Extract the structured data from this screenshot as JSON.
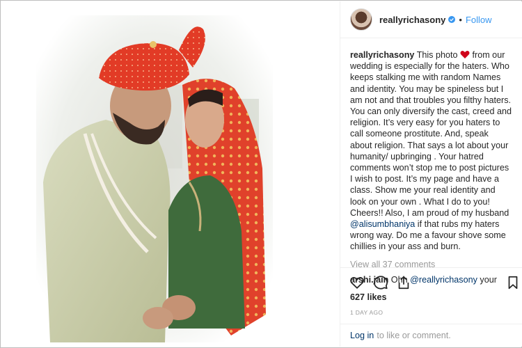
{
  "post": {
    "username": "reallyrichasony",
    "dot": "•",
    "follow_label": "Follow",
    "caption_user": "reallyrichasony",
    "caption_part1": "This photo",
    "caption_part2": "from our wedding is especially for the haters. Who keeps stalking me with random Names and identity. You may be spineless but I am not and that troubles you filthy haters. You can only diversify the cast, creed and religion. It’s very easy for you haters to call someone prostitute. And, speak about religion. That says a lot about your humanity/ upbringing . Your hatred comments won’t stop me to post pictures I wish to post. It’s my page and have a class. Show me your real identity and look on your own . What I do to you! Cheers!! Also, I am proud of my husband",
    "caption_mention": "@alisumbhaniya",
    "caption_part3": "if that rubs my haters wrong way. Do me a favour shove some chillies in your ass and burn.",
    "view_all": "View all 37 comments",
    "comment_user": "arshi.jain",
    "comment_text": "Ohh",
    "comment_mention": "@reallyrichasony",
    "comment_tail": "your",
    "likes": "627 likes",
    "time": "1 DAY AGO",
    "login_link": "Log in",
    "login_text": "to like or comment."
  },
  "colors": {
    "accent": "#3897f0",
    "heart": "#ed4956",
    "mention": "#003569"
  },
  "icons": [
    "heart-icon",
    "comment-icon",
    "share-icon",
    "bookmark-icon",
    "verified-icon"
  ]
}
